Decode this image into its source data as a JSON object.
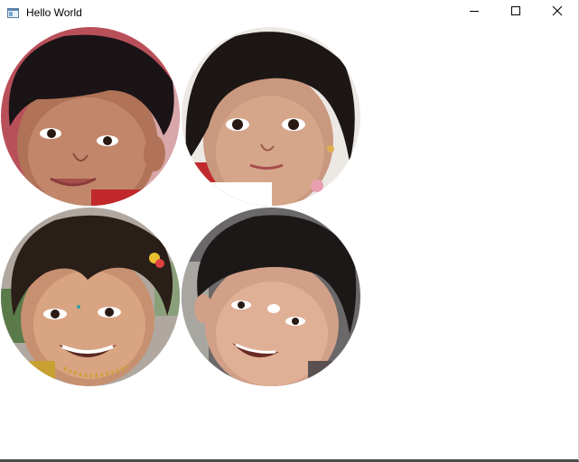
{
  "window": {
    "title": "Hello World",
    "icon": "app-window-icon",
    "controls": {
      "minimize_icon": "minimize-icon",
      "maximize_icon": "maximize-icon",
      "close_icon": "close-icon"
    }
  },
  "photos": [
    {
      "name": "child-photo-boy-1",
      "shape": "circle"
    },
    {
      "name": "child-photo-girl-1",
      "shape": "circle"
    },
    {
      "name": "child-photo-girl-2",
      "shape": "circle"
    },
    {
      "name": "child-photo-boy-2",
      "shape": "circle"
    }
  ],
  "colors": {
    "background": "#ffffff",
    "title_text": "#000000",
    "bottom_border": "#4a4a4a"
  }
}
